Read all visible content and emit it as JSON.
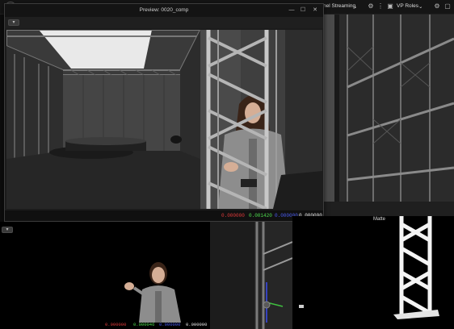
{
  "topbar": {
    "logo": "U",
    "streaming_label": "nel Streaming",
    "vp_roles_label": "VP Roles",
    "chevron": "⌄"
  },
  "preview": {
    "title": "Preview: 0020_comp",
    "toolbar_button": "▾",
    "pixel_values": {
      "red": "0.000000",
      "green": "0.001420",
      "blue": "0.000000",
      "alpha": "0.000000"
    }
  },
  "bottom_left": {
    "button": "▾",
    "pixel_values": {
      "red": "0.000000",
      "green": "0.000046",
      "blue": "0.000000",
      "alpha": "0.000000"
    }
  },
  "matte": {
    "title": "Matte"
  },
  "colors": {
    "red": "#e03a3a",
    "green": "#4fdc4f",
    "blue": "#4a5cf0",
    "white": "#e6e6e6"
  }
}
